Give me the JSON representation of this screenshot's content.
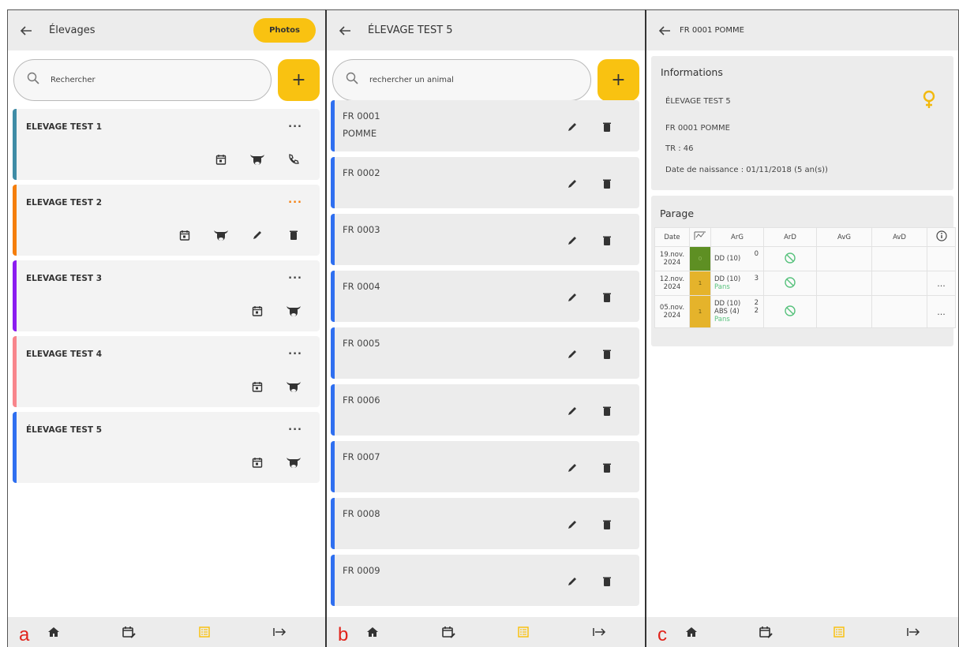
{
  "screen_a": {
    "title": "Élevages",
    "photos_label": "Photos",
    "search_placeholder": "Rechercher",
    "add_label": "+",
    "more_label": "...",
    "farms": [
      {
        "name": "ELEVAGE TEST 1",
        "color": "#3f8ca6",
        "actions": [
          "calendar-icon",
          "cow-icon",
          "phone-icon"
        ]
      },
      {
        "name": "ELEVAGE TEST 2",
        "color": "#f57e0c",
        "actions": [
          "calendar-icon",
          "cow-icon",
          "edit-icon",
          "delete-icon"
        ]
      },
      {
        "name": "ELEVAGE TEST 3",
        "color": "#8b1cf0",
        "actions": [
          "calendar-icon",
          "cow-icon"
        ]
      },
      {
        "name": "ELEVAGE TEST 4",
        "color": "#f8868c",
        "actions": [
          "calendar-icon",
          "cow-icon"
        ]
      },
      {
        "name": "ÉLEVAGE TEST 5",
        "color": "#2f6ff0",
        "actions": [
          "calendar-icon",
          "cow-icon"
        ]
      }
    ],
    "panel_label": "a"
  },
  "screen_b": {
    "title": "ÉLEVAGE TEST 5",
    "search_placeholder": "rechercher un animal",
    "add_label": "+",
    "animals": [
      {
        "id": "FR 0001",
        "name": "POMME"
      },
      {
        "id": "FR 0002",
        "name": ""
      },
      {
        "id": "FR 0003",
        "name": ""
      },
      {
        "id": "FR 0004",
        "name": ""
      },
      {
        "id": "FR 0005",
        "name": ""
      },
      {
        "id": "FR 0006",
        "name": ""
      },
      {
        "id": "FR 0007",
        "name": ""
      },
      {
        "id": "FR 0008",
        "name": ""
      },
      {
        "id": "FR 0009",
        "name": ""
      }
    ],
    "panel_label": "b"
  },
  "screen_c": {
    "title": "FR 0001 POMME",
    "info": {
      "heading": "Informations",
      "farm": "ÉLEVAGE TEST 5",
      "animal": "FR 0001 POMME",
      "tr": "TR : 46",
      "birth": "Date de naissance : 01/11/2018 (5 an(s))"
    },
    "parage": {
      "heading": "Parage",
      "headers": [
        "Date",
        "ArG",
        "ArD",
        "AvG",
        "AvD"
      ],
      "rows": [
        {
          "date_1": "19.nov.",
          "date_2": "2024",
          "score": "0",
          "score_color": "#5e8f23",
          "lesions": [
            "DD (10)"
          ],
          "values": [
            "0"
          ],
          "note": "",
          "more": ""
        },
        {
          "date_1": "12.nov.",
          "date_2": "2024",
          "score": "1",
          "score_color": "#e5b32b",
          "lesions": [
            "DD (10)"
          ],
          "values": [
            "3"
          ],
          "note": "Pans",
          "more": "..."
        },
        {
          "date_1": "05.nov.",
          "date_2": "2024",
          "score": "1",
          "score_color": "#e5b32b",
          "lesions": [
            "DD (10)",
            "ABS (4)"
          ],
          "values": [
            "2",
            "2"
          ],
          "note": "Pans",
          "more": "..."
        }
      ]
    },
    "panel_label": "c"
  },
  "colors": {
    "accent": "#f9c211",
    "stripe_blue": "#2f6ff0",
    "panel_label": "#e0231b",
    "ok_green": "#58c27d"
  },
  "nav": [
    "home-icon",
    "calendar-edit-icon",
    "list-icon",
    "logout-icon"
  ]
}
